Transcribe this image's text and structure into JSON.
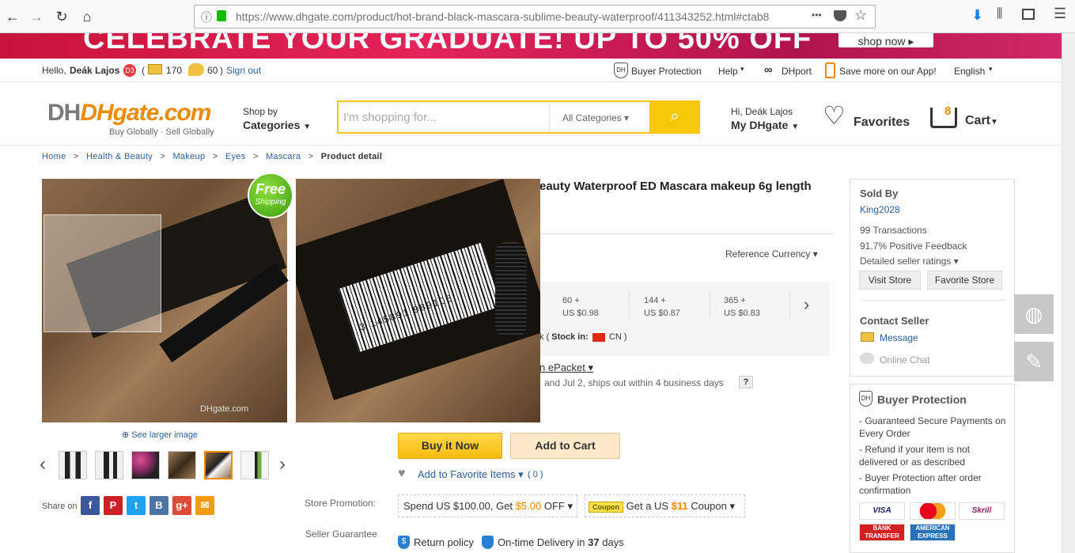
{
  "browser": {
    "url": "https://www.dhgate.com/product/hot-brand-black-mascara-sublime-beauty-waterproof/411343252.html#ctab8",
    "menu_dots": "•••"
  },
  "banner": {
    "headline": "CELEBRATE YOUR GRADUATE!   UP TO 50% OFF",
    "shop_now": "shop now ▸"
  },
  "topbar": {
    "hello": "Hello,",
    "user": "Deák Lajos",
    "level": "D3",
    "messages": "170",
    "notifications": "60",
    "paren_open": "(",
    "paren_close": ")",
    "sign_out": "Sign out",
    "buyer_protection": "Buyer Protection",
    "help": "Help",
    "dhport": "DHport",
    "app": "Save more on our App!",
    "language": "English"
  },
  "header": {
    "logo_main": "DHgate.com",
    "logo_tagline": "Buy Globally · Sell Globally",
    "shop_by": "Shop by",
    "categories": "Categories",
    "search_placeholder": "I'm shopping for...",
    "all_categories": "All Categories",
    "hi_user": "Hi, Deák Lajos",
    "my_dhgate": "My DHgate",
    "favorites": "Favorites",
    "cart": "Cart",
    "cart_count": "8"
  },
  "breadcrumb": [
    {
      "label": "Home"
    },
    {
      "label": "Health & Beauty"
    },
    {
      "label": "Makeup"
    },
    {
      "label": "Eyes"
    },
    {
      "label": "Mascara"
    },
    {
      "label": "Product detail"
    }
  ],
  "breadcrumb_sep": ">",
  "gallery": {
    "badge_line1": "Free",
    "badge_line2": "Shipping",
    "see_larger": "See larger image",
    "watermark": "DHgate.com",
    "barcode_digits": "3 145891 989106",
    "share_on": "Share on",
    "prev": "‹",
    "next": "›"
  },
  "product": {
    "title_visible": "eauty Waterproof ED Mascara makeup 6g length",
    "reference_currency": "Reference Currency",
    "tiers": [
      {
        "qty": "60 +",
        "price": "US $0.98"
      },
      {
        "qty": "144 +",
        "price": "US $0.87"
      },
      {
        "qty": "365 +",
        "price": "US $0.83"
      }
    ],
    "stock_prefix": "k (",
    "stock_label": "Stock in:",
    "stock_country": "CN )",
    "shipping_method": "n ePacket",
    "delivery_text": "and Jul 2, ships out within 4 business days",
    "help_q": "?",
    "buy_now": "Buy it Now",
    "add_to_cart": "Add to Cart",
    "add_favorite": "Add to Favorite Items",
    "favorite_count": "( 0 )",
    "store_promotion_label": "Store Promotion:",
    "promo": "Spend US $100.00, Get",
    "promo_off": "$5.00",
    "promo_off_suffix": "OFF",
    "coupon_tag": "Coupon",
    "coupon_text": "Get a US",
    "coupon_amount": "$11",
    "coupon_suffix": "Coupon",
    "seller_guarantee_label": "Seller Guarantee",
    "return_policy": "Return policy",
    "ontime": "On-time Delivery in",
    "ontime_days": "37",
    "ontime_suffix": "days"
  },
  "seller": {
    "sold_by": "Sold By",
    "name": "King2028",
    "transactions_num": "99",
    "transactions": "Transactions",
    "feedback_num": "91.7%",
    "feedback": "Positive Feedback",
    "ratings": "Detailed seller ratings",
    "visit_store": "Visit Store",
    "favorite_store": "Favorite Store",
    "contact": "Contact Seller",
    "message": "Message",
    "online_chat": "Online Chat"
  },
  "protection": {
    "title": "Buyer Protection",
    "items": [
      "- Guaranteed Secure Payments on Every Order",
      "- Refund if your item is not delivered or as described",
      "- Buyer Protection after order confirmation"
    ],
    "payments": [
      "VISA",
      "MC",
      "Skrill",
      "BANK TRANSFER",
      "AMERICAN EXPRESS"
    ]
  },
  "colors": {
    "brand_yellow": "#f7c70a",
    "link_blue": "#2a5f9e",
    "orange": "#ff6600"
  }
}
